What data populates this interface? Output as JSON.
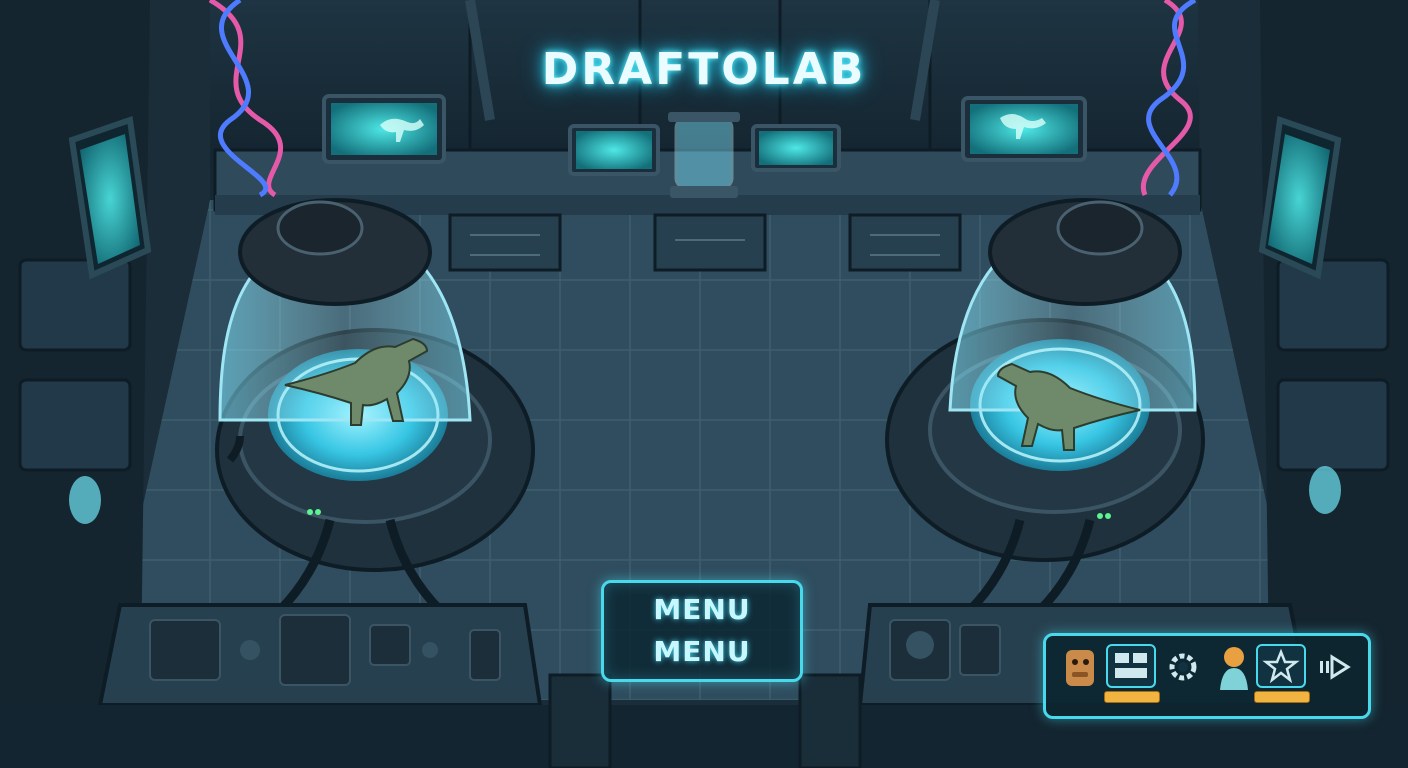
{
  "game": {
    "title": "DRAFTOLAB",
    "menu_button": {
      "line1": "MENU",
      "line2": "MENU"
    }
  },
  "toolbar": {
    "items": [
      {
        "icon": "dino-portrait-icon"
      },
      {
        "icon": "grid-panel-icon"
      },
      {
        "icon": "gear-icon"
      },
      {
        "icon": "scientist-avatar-icon"
      },
      {
        "icon": "star-icon"
      },
      {
        "icon": "fast-forward-icon"
      }
    ]
  },
  "colors": {
    "accent": "#48d9ec",
    "title_glow": "#5ff3ff",
    "badge": "#f2b440",
    "floor": "#2c4a5c",
    "dna_pink": "#e45aa8",
    "dna_blue": "#4f7bff"
  }
}
